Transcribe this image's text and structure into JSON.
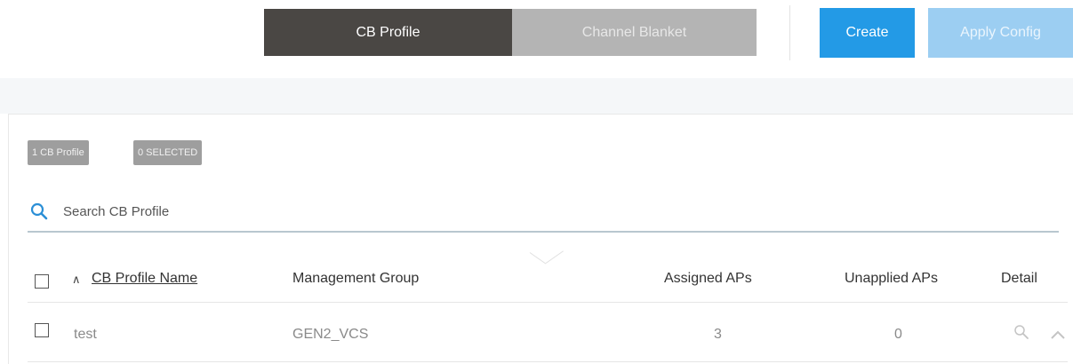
{
  "toolbar": {
    "tabs": [
      "CB Profile",
      "Channel Blanket"
    ],
    "create_label": "Create",
    "apply_label": "Apply Config"
  },
  "summary": {
    "count_badge": "1 CB Profile",
    "selected_badge": "0 SELECTED"
  },
  "search": {
    "placeholder": "Search CB Profile"
  },
  "table": {
    "columns": [
      "CB Profile Name",
      "Management Group",
      "Assigned APs",
      "Unapplied APs",
      "Detail"
    ],
    "rows": [
      {
        "name": "test",
        "group": "GEN2_VCS",
        "assigned": "3",
        "unapplied": "0"
      }
    ]
  },
  "colors": {
    "active_tab": "#4a4744",
    "inactive_tab": "#b4b4b4",
    "create_button": "#239ae6",
    "apply_button": "#9ccef2",
    "badge": "#9e9e9e",
    "search_icon": "#2b8fd6"
  },
  "icons": {
    "search": "search-icon",
    "sort": "sort-ascending-icon",
    "detail": "magnifier-icon",
    "expand": "chevron-up-icon"
  }
}
